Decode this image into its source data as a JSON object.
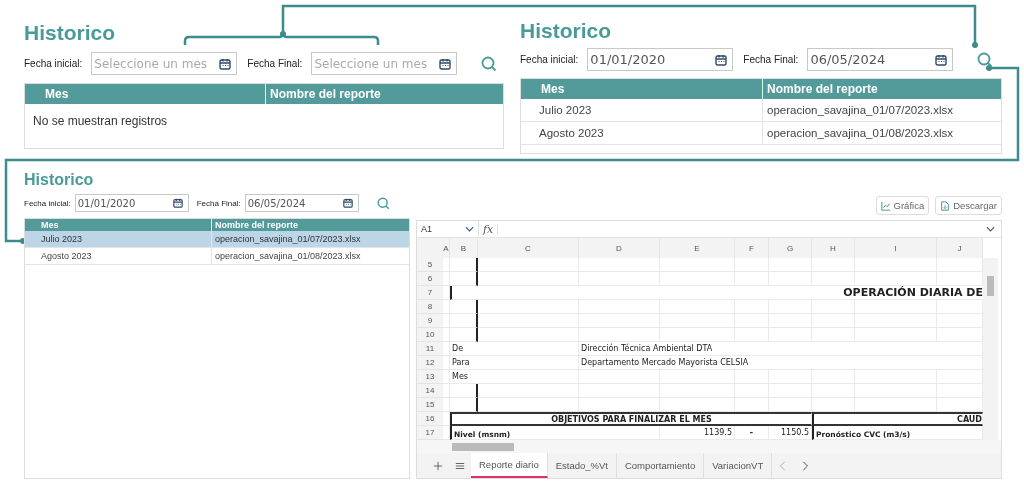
{
  "panels": [
    {
      "title": "Historico",
      "start": {
        "label": "Fecha inicial:",
        "placeholder": "Seleccione un mes"
      },
      "end": {
        "label": "Fecha Final:",
        "placeholder": "Seleccione un mes"
      },
      "columns": [
        "Mes",
        "Nombre del reporte"
      ],
      "empty_message": "No se muestran registros"
    },
    {
      "title": "Historico",
      "start": {
        "label": "Fecha inicial:",
        "value": "01/01/2020"
      },
      "end": {
        "label": "Fecha Final:",
        "value": "06/05/2024"
      },
      "columns": [
        "Mes",
        "Nombre del reporte"
      ],
      "rows": [
        {
          "month": "Julio 2023",
          "file": "operacion_savajina_01/07/2023.xlsx",
          "selected": false
        },
        {
          "month": "Agosto 2023",
          "file": "operacion_savajina_01/08/2023.xlsx",
          "selected": false
        }
      ]
    },
    {
      "title": "Historico",
      "start": {
        "label": "Fecha inicial:",
        "value": "01/01/2020"
      },
      "end": {
        "label": "Fecha Final:",
        "value": "06/05/2024"
      },
      "columns": [
        "Mes",
        "Nombre del reporte"
      ],
      "rows": [
        {
          "month": "Julio 2023",
          "file": "operacion_savajina_01/07/2023.xlsx",
          "selected": true
        },
        {
          "month": "Agosto 2023",
          "file": "operacion_savajina_01/08/2023.xlsx",
          "selected": false
        }
      ]
    }
  ],
  "sheet": {
    "buttons": [
      {
        "kind": "chart",
        "label": "Gráfica"
      },
      {
        "kind": "download",
        "label": "Descargar"
      }
    ],
    "cell_ref": "A1",
    "formula_icon": "fx",
    "columns": [
      "A",
      "B",
      "C",
      "D",
      "E",
      "F",
      "G",
      "H",
      "I",
      "J"
    ],
    "rows": [
      {
        "number": "5"
      },
      {
        "number": "6"
      },
      {
        "number": "7",
        "cells": {
          "B": {
            "kind": "title",
            "text": "OPERACIÓN DIARIA DE"
          }
        }
      },
      {
        "number": "8"
      },
      {
        "number": "9"
      },
      {
        "number": "10"
      },
      {
        "number": "11",
        "cells": {
          "B": {
            "kind": "label",
            "text": "De"
          },
          "D": {
            "kind": "label",
            "text": "Dirección Técnica Ambiental DTA"
          }
        }
      },
      {
        "number": "12",
        "cells": {
          "B": {
            "kind": "label",
            "text": "Para"
          },
          "D": {
            "kind": "label",
            "text": "Departamento Mercado Mayorista CELSIA"
          }
        }
      },
      {
        "number": "13",
        "cells": {
          "B": {
            "kind": "label",
            "text": "Mes"
          }
        }
      },
      {
        "number": "14"
      },
      {
        "number": "15"
      },
      {
        "number": "16",
        "cells": {
          "B": {
            "kind": "heading",
            "text": "OBJETIVOS PARA FINALIZAR EL MES"
          },
          "H": {
            "kind": "heading_end",
            "text": "CAUD"
          }
        }
      },
      {
        "number": "17",
        "cells": {
          "B": {
            "kind": "bold_label",
            "text": "Nivel (msnm)"
          },
          "E": {
            "kind": "number",
            "text": "1139.5"
          },
          "F": {
            "kind": "center",
            "text": "-"
          },
          "G": {
            "kind": "number",
            "text": "1150.5"
          },
          "H": {
            "kind": "bold_label",
            "text": "Pronóstico CVC (m3/s)"
          }
        }
      }
    ],
    "tabs": [
      {
        "label": "Reporte diario",
        "selected": true
      },
      {
        "label": "Estado_%Vt",
        "selected": false
      },
      {
        "label": "Comportamiento",
        "selected": false
      },
      {
        "label": "VariacionVT",
        "selected": false
      }
    ]
  }
}
